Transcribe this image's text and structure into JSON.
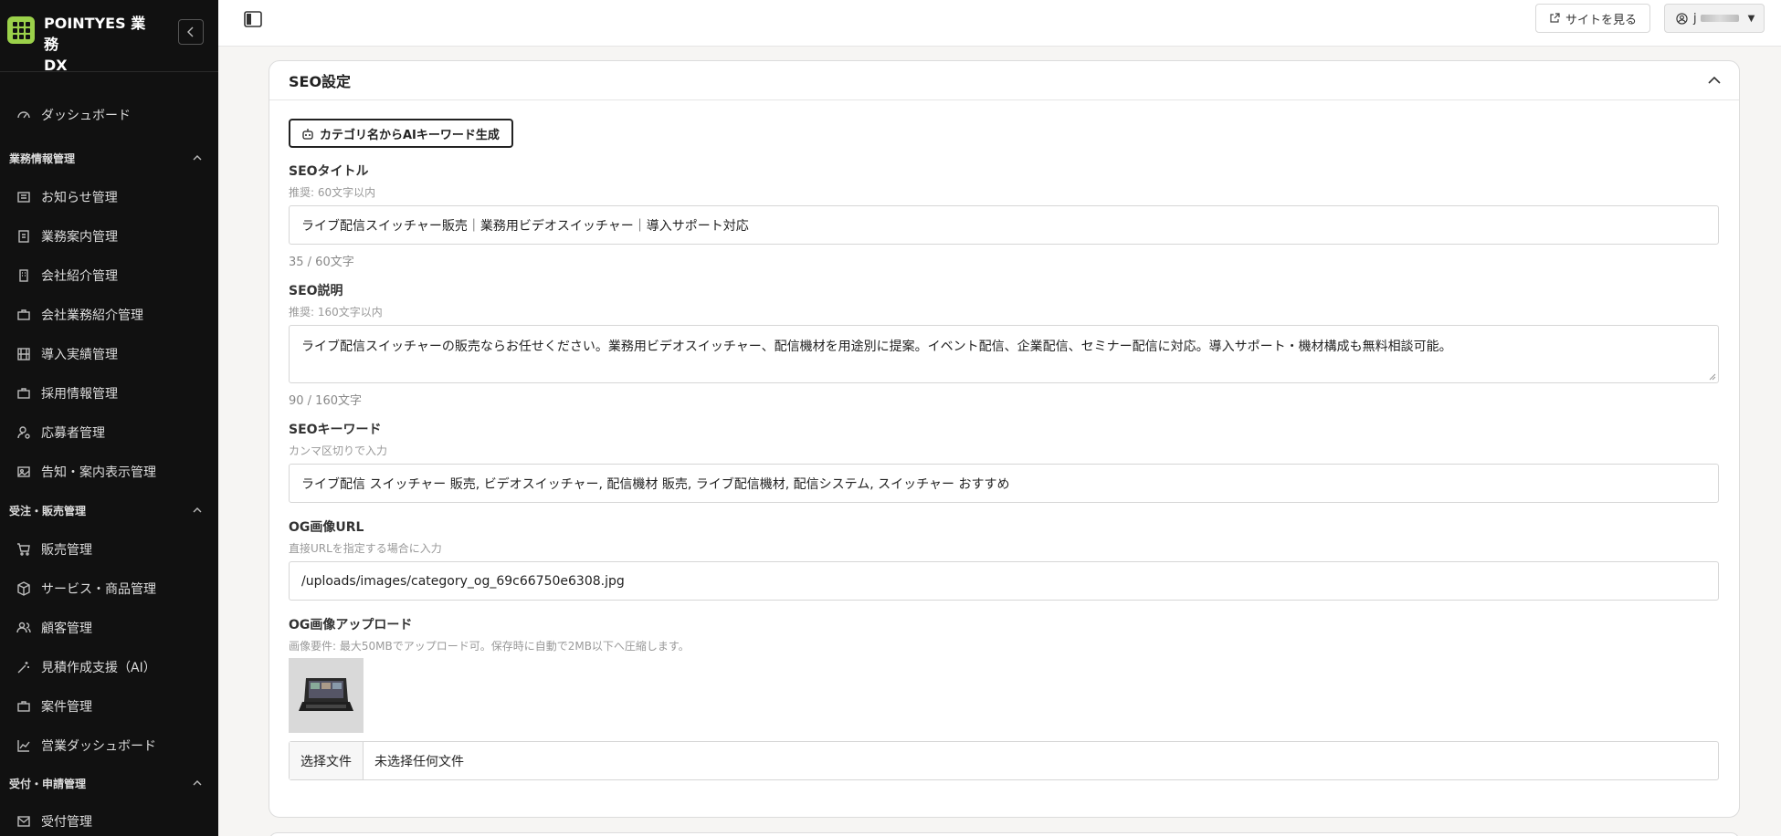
{
  "app": {
    "title_line1": "POINTYES 業務",
    "title_line2": "DX"
  },
  "sidebar": {
    "top_items": [
      {
        "label": "ダッシュボード",
        "icon": "gauge-icon"
      }
    ],
    "sections": [
      {
        "title": "業務情報管理",
        "items": [
          {
            "label": "お知らせ管理",
            "icon": "newspaper-icon"
          },
          {
            "label": "業務案内管理",
            "icon": "document-icon"
          },
          {
            "label": "会社紹介管理",
            "icon": "building-icon"
          },
          {
            "label": "会社業務紹介管理",
            "icon": "briefcase-icon"
          },
          {
            "label": "導入実績管理",
            "icon": "film-icon"
          },
          {
            "label": "採用情報管理",
            "icon": "briefcase-icon"
          },
          {
            "label": "応募者管理",
            "icon": "user-cog-icon"
          },
          {
            "label": "告知・案内表示管理",
            "icon": "image-icon"
          }
        ]
      },
      {
        "title": "受注・販売管理",
        "items": [
          {
            "label": "販売管理",
            "icon": "cart-icon"
          },
          {
            "label": "サービス・商品管理",
            "icon": "box-icon"
          },
          {
            "label": "顧客管理",
            "icon": "users-icon"
          },
          {
            "label": "見積作成支援（AI）",
            "icon": "magic-wand-icon"
          },
          {
            "label": "案件管理",
            "icon": "briefcase-icon"
          },
          {
            "label": "営業ダッシュボード",
            "icon": "chart-line-icon"
          }
        ]
      },
      {
        "title": "受付・申請管理",
        "items": [
          {
            "label": "受付管理",
            "icon": "mail-icon"
          }
        ]
      }
    ]
  },
  "topbar": {
    "site_button": "サイトを見る",
    "user_initial": "j"
  },
  "seo": {
    "section_title": "SEO設定",
    "ai_button": "カテゴリ名からAIキーワード生成",
    "title_label": "SEOタイトル",
    "title_hint": "推奨: 60文字以内",
    "title_value": "ライブ配信スイッチャー販売｜業務用ビデオスイッチャー｜導入サポート対応",
    "title_counter": "35 / 60文字",
    "desc_label": "SEO説明",
    "desc_hint": "推奨: 160文字以内",
    "desc_value": "ライブ配信スイッチャーの販売ならお任せください。業務用ビデオスイッチャー、配信機材を用途別に提案。イベント配信、企業配信、セミナー配信に対応。導入サポート・機材構成も無料相談可能。",
    "desc_counter": "90 / 160文字",
    "keywords_label": "SEOキーワード",
    "keywords_hint": "カンマ区切りで入力",
    "keywords_value": "ライブ配信 スイッチャー 販売, ビデオスイッチャー, 配信機材 販売, ライブ配信機材, 配信システム, スイッチャー おすすめ",
    "og_url_label": "OG画像URL",
    "og_url_hint": "直接URLを指定する場合に入力",
    "og_url_value": "/uploads/images/category_og_69c66750e6308.jpg",
    "og_upload_label": "OG画像アップロード",
    "og_upload_hint": "画像要件: 最大50MBでアップロード可。保存時に自動で2MB以下へ圧縮します。",
    "file_choose": "选择文件",
    "file_none": "未选择任何文件"
  }
}
